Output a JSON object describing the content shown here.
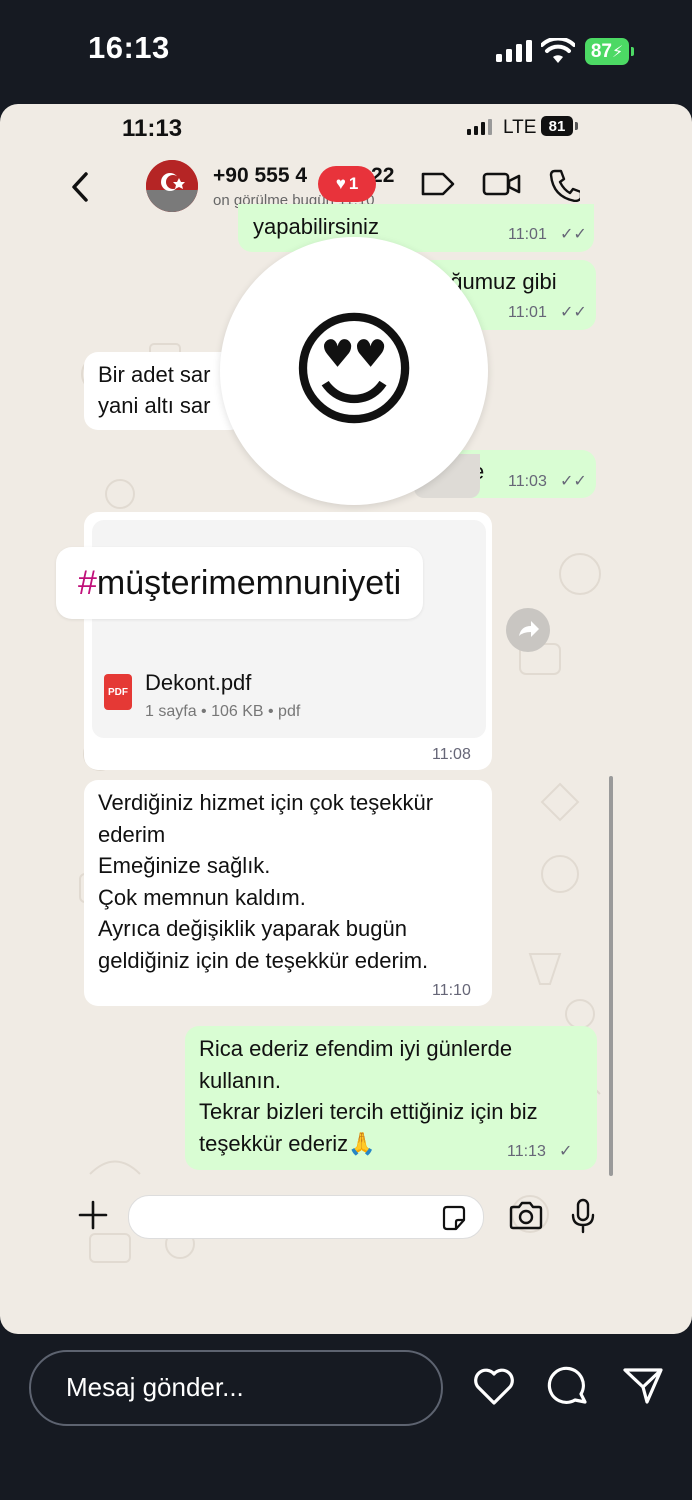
{
  "status_bar": {
    "time": "16:13",
    "battery": "87"
  },
  "chat_screenshot": {
    "status_bar": {
      "time": "11:13",
      "network": "LTE",
      "battery": "81"
    },
    "header": {
      "contact_name": "+90 555 4",
      "contact_name_end": "22",
      "last_seen": "on görülme bugün 11:10",
      "like_count": "1"
    },
    "messages": {
      "out_1": {
        "text": "yapabilirsiniz",
        "time": "11:01"
      },
      "out_2": {
        "text": "uğumuz gibi",
        "time": "11:01"
      },
      "in_1": {
        "line1": "Bir adet sar",
        "line2": "yani altı sar"
      },
      "out_3": {
        "text": "e",
        "time": "11:03"
      },
      "doc": {
        "hashtag_mark": "#",
        "hashtag_word": "müşterimemnuniyeti",
        "file_name": "Dekont.pdf",
        "file_meta": "1 sayfa • 106 KB • pdf",
        "pdf_label": "PDF",
        "time": "11:08"
      },
      "in_2": {
        "lines": [
          "Verdiğiniz hizmet için çok teşekkür",
          "ederim",
          "Emeğinize sağlık.",
          "Çok memnun kaldım.",
          "Ayrıca değişiklik yaparak bugün",
          "geldiğiniz için de teşekkür ederim."
        ],
        "time": "11:10"
      },
      "out_4": {
        "lines": [
          "Rica ederiz efendim iyi günlerde",
          "kullanın.",
          "Tekrar bizleri tercih ettiğiniz için biz",
          "teşekkür ederiz🙏"
        ],
        "time": "11:13"
      }
    },
    "reaction_emoji": "😍",
    "input": {
      "placeholder": ""
    }
  },
  "story_reply": {
    "placeholder": "Mesaj gönder..."
  },
  "colors": {
    "outgoing_bubble": "#d9fdd3",
    "incoming_bubble": "#ffffff",
    "like_badge": "#e8333b",
    "battery_green": "#4cd964",
    "hashtag": "#c0107a"
  }
}
